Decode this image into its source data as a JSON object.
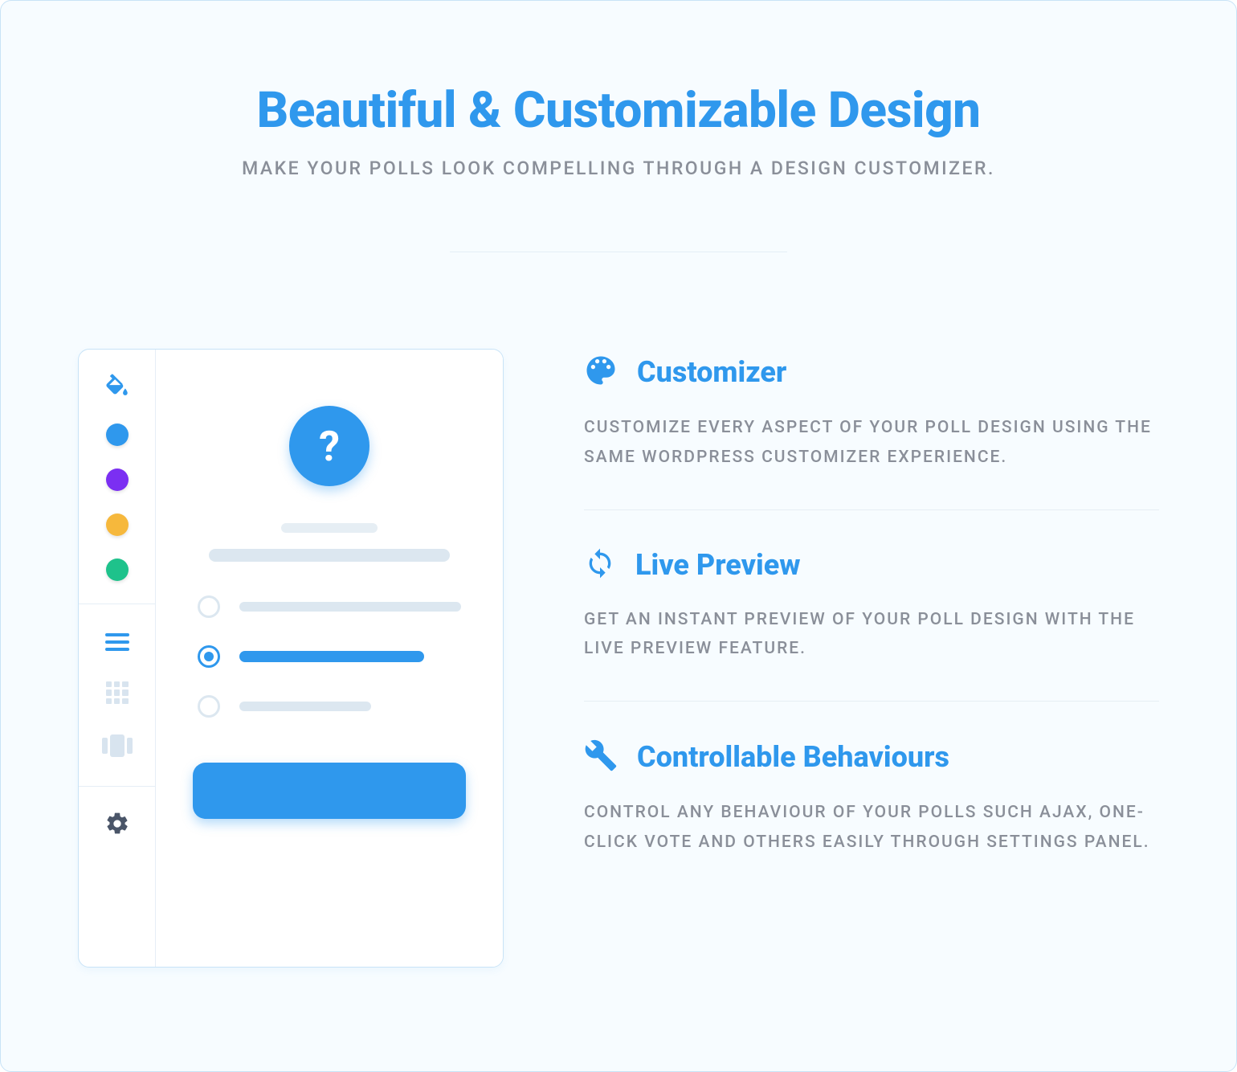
{
  "header": {
    "title": "Beautiful & Customizable Design",
    "subtitle": "MAKE YOUR POLLS LOOK COMPELLING THROUGH A DESIGN CUSTOMIZER."
  },
  "mockup": {
    "question_badge": "?",
    "swatches": [
      "blue",
      "purple",
      "orange",
      "green"
    ],
    "tool_icons": [
      "fill",
      "menu",
      "grid",
      "carousel",
      "gear"
    ]
  },
  "features": [
    {
      "icon": "palette",
      "title": "Customizer",
      "desc": "CUSTOMIZE EVERY ASPECT OF YOUR POLL DESIGN USING THE SAME WORDPRESS CUSTOMIZER EXPERIENCE."
    },
    {
      "icon": "refresh",
      "title": "Live Preview",
      "desc": "GET AN INSTANT PREVIEW OF YOUR POLL DESIGN WITH THE LIVE PREVIEW FEATURE."
    },
    {
      "icon": "wrench",
      "title": "Controllable Behaviours",
      "desc": "CONTROL ANY BEHAVIOUR OF YOUR POLLS SUCH AJAX, ONE-CLICK VOTE AND OTHERS EASILY THROUGH SETTINGS PANEL."
    }
  ]
}
